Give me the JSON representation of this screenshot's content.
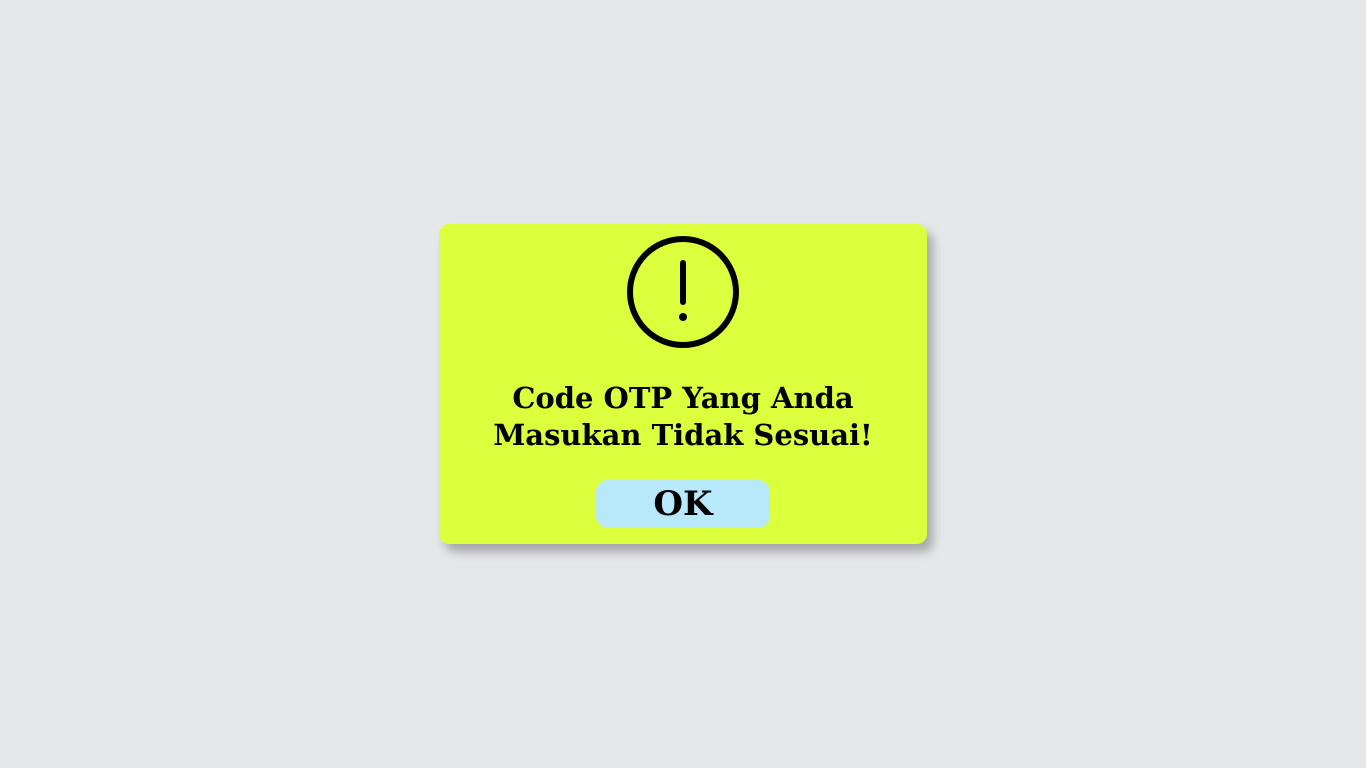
{
  "dialog": {
    "icon": "alert-circle-icon",
    "message_line1": "Code OTP Yang Anda",
    "message_line2": "Masukan Tidak Sesuai!",
    "ok_label": "OK"
  },
  "colors": {
    "background": "#e6e7ea",
    "dialog": "#dbff3c",
    "button": "#b8e9fb",
    "text": "#000000"
  }
}
